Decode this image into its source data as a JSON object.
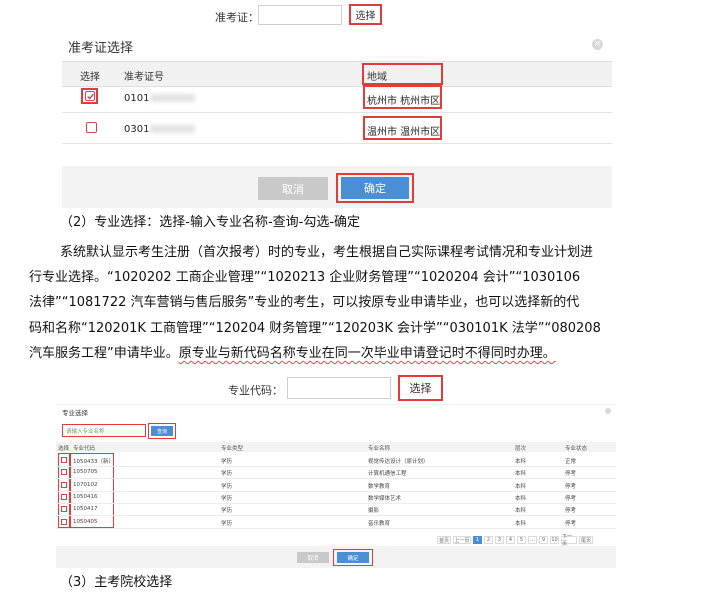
{
  "ticket_section": {
    "label": "准考证：",
    "select_button": "选择",
    "dialog": {
      "title": "准考证选择",
      "close_glyph": "×",
      "headers": {
        "select": "选择",
        "ticket_no": "准考证号",
        "region": "地域"
      },
      "rows": [
        {
          "ticket_no": "0101",
          "region": "杭州市 杭州市区",
          "checked": true
        },
        {
          "ticket_no": "0301",
          "region": "温州市 温州市区",
          "checked": false
        }
      ],
      "cancel_button": "取消",
      "confirm_button": "确定"
    }
  },
  "text": {
    "step2_heading": "（2）专业选择：选择-输入专业名称-查询-勾选-确定",
    "para_lines": [
      "系统默认显示考生注册（首次报考）时的专业，考生根据自己实际课程考试情况和专业计划进",
      "行专业选择。“1020202 工商企业管理”“1020213 企业财务管理”“1020204 会计”“1030106",
      "法律”“1081722 汽车营销与售后服务”专业的考生，可以按原专业申请毕业，也可以选择新的代",
      "码和名称“120201K 工商管理”“120204 财务管理”“120203K 会计学”“030101K 法学”“080208"
    ],
    "last_line_plain": "汽车服务工程”申请毕业。",
    "last_line_squiggle": "原专业与新代码名称专业在同一次毕业申请登记时不得同时办理。",
    "step3_heading": "（3）主考院校选择"
  },
  "major_section": {
    "label": "专业代码：",
    "select_button": "选择",
    "dialog": {
      "title": "专业选择",
      "search_placeholder": "请输入专业名称",
      "query_button": "查询",
      "headers": [
        "选择",
        "专业代码",
        "专业类型",
        "专业名称",
        "层次",
        "专业状态"
      ],
      "rows": [
        [
          "1050433（新）",
          "学历",
          "视觉传达设计（原计划）",
          "本科",
          "正常"
        ],
        [
          "1050705",
          "学历",
          "计算机通信工程",
          "本科",
          "停考"
        ],
        [
          "1070102",
          "学历",
          "数学教育",
          "本科",
          "停考"
        ],
        [
          "1050416",
          "学历",
          "数学媒体艺术",
          "本科",
          "停考"
        ],
        [
          "1050417",
          "学历",
          "摄影",
          "本科",
          "停考"
        ],
        [
          "1050405",
          "学历",
          "音乐教育",
          "本科",
          "停考"
        ]
      ],
      "pagination": {
        "prev_label": "首页",
        "prev2_label": "上一页",
        "pages": [
          "1",
          "2",
          "3",
          "4",
          "5",
          "…",
          "9",
          "10"
        ],
        "next_label": "下一页",
        "last_label": "尾页"
      },
      "cancel_button": "取消",
      "confirm_button": "确定"
    }
  },
  "colors": {
    "accent": "#4a8fd6",
    "highlight": "#e23b3b"
  }
}
